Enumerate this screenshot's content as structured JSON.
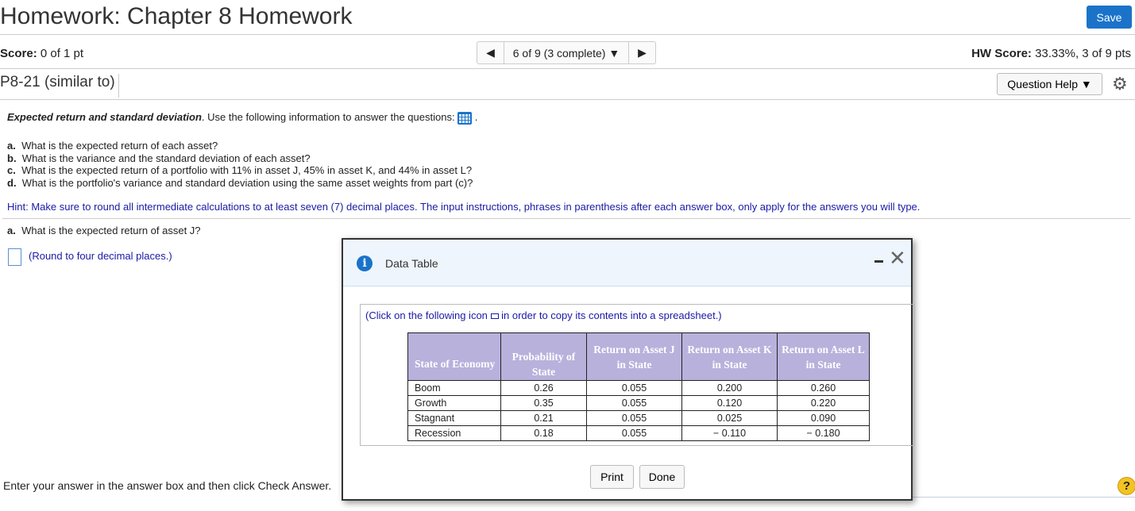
{
  "header": {
    "title": "Homework: Chapter 8 Homework",
    "save_label": "Save"
  },
  "scorebar": {
    "score_label": "Score:",
    "score_value": " 0 of 1 pt",
    "nav_text": "6 of 9 (3 complete)",
    "hw_label": "HW Score:",
    "hw_value": " 33.33%, 3 of 9 pts"
  },
  "problem": {
    "id": "P8-21 (similar to)",
    "help_label": "Question Help"
  },
  "question": {
    "intro_bold": "Expected return and standard deviation",
    "intro_rest": ".  Use the following information to answer the questions:",
    "parts": [
      {
        "letter": "a.",
        "text": "What is the expected return of each asset?"
      },
      {
        "letter": "b.",
        "text": "What is the variance and the standard deviation of each asset?"
      },
      {
        "letter": "c.",
        "text": "What is the expected return of a portfolio with 11% in asset J, 45% in asset K, and 44% in asset L?"
      },
      {
        "letter": "d.",
        "text": "What is the portfolio's variance and standard deviation using the same asset weights from part (c)?"
      }
    ],
    "hint": "Hint: Make sure to round all intermediate calculations to at least seven (7) decimal places. The input instructions, phrases in parenthesis after each answer box, only apply for the answers you will type.",
    "sub_letter": "a.",
    "sub_text": "What is the expected return of asset J?",
    "round_note": "(Round to four decimal places.)",
    "footer": "Enter your answer in the answer box and then click Check Answer."
  },
  "modal": {
    "title": "Data Table",
    "copy_pre": "(Click on the following icon ",
    "copy_post": "  in order to copy its contents into a spreadsheet.)",
    "headers": [
      "State of Economy",
      "Probability of State",
      "Return on Asset J in State",
      "Return on Asset K in State",
      "Return on Asset L in State"
    ],
    "rows": [
      [
        "Boom",
        "0.26",
        "0.055",
        "0.200",
        "0.260"
      ],
      [
        "Growth",
        "0.35",
        "0.055",
        "0.120",
        "0.220"
      ],
      [
        "Stagnant",
        "0.21",
        "0.055",
        "0.025",
        "0.090"
      ],
      [
        "Recession",
        "0.18",
        "0.055",
        "− 0.110",
        "− 0.180"
      ]
    ],
    "print_label": "Print",
    "done_label": "Done"
  },
  "colors": {
    "accent": "#1a73c9",
    "table_header": "#b8b1dc",
    "hint": "#1a1aa6"
  }
}
